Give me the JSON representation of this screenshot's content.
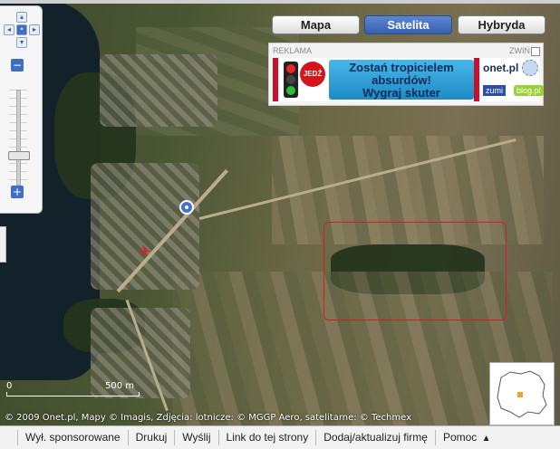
{
  "map_type": {
    "buttons": [
      {
        "label": "Mapa",
        "active": false
      },
      {
        "label": "Satelita",
        "active": true
      },
      {
        "label": "Hybryda",
        "active": false
      }
    ]
  },
  "navigation": {
    "pan_up": "▴",
    "pan_down": "▾",
    "pan_left": "◂",
    "pan_right": "▸",
    "center": "•",
    "zoom_out": "−",
    "zoom_in": "+"
  },
  "ad": {
    "label": "REKLAMA",
    "close": "ZWIŃ",
    "sign_text": "JEDŹ",
    "headline": "Zostań tropicielem absurdów! Wygraj skuter",
    "brand": "onet.pl",
    "zumi": "zumi",
    "blog": "blog.pl"
  },
  "scale": {
    "start": "0",
    "end": "500 m"
  },
  "attribution": "© 2009 Onet.pl, Mapy © Imagis, Zdjęcia: lotnicze: © MGGP Aero, satelitarne: © Techmex",
  "toolbar": {
    "items": [
      "Wył. sponsorowane",
      "Drukuj",
      "Wyślij",
      "Link do tej strony",
      "Dodaj/aktualizuj firmę",
      "Pomoc"
    ],
    "help_arrow": "▲"
  },
  "colors": {
    "accent": "#3d6fc2",
    "selection": "#d22020",
    "ad_red": "#c8102e"
  }
}
